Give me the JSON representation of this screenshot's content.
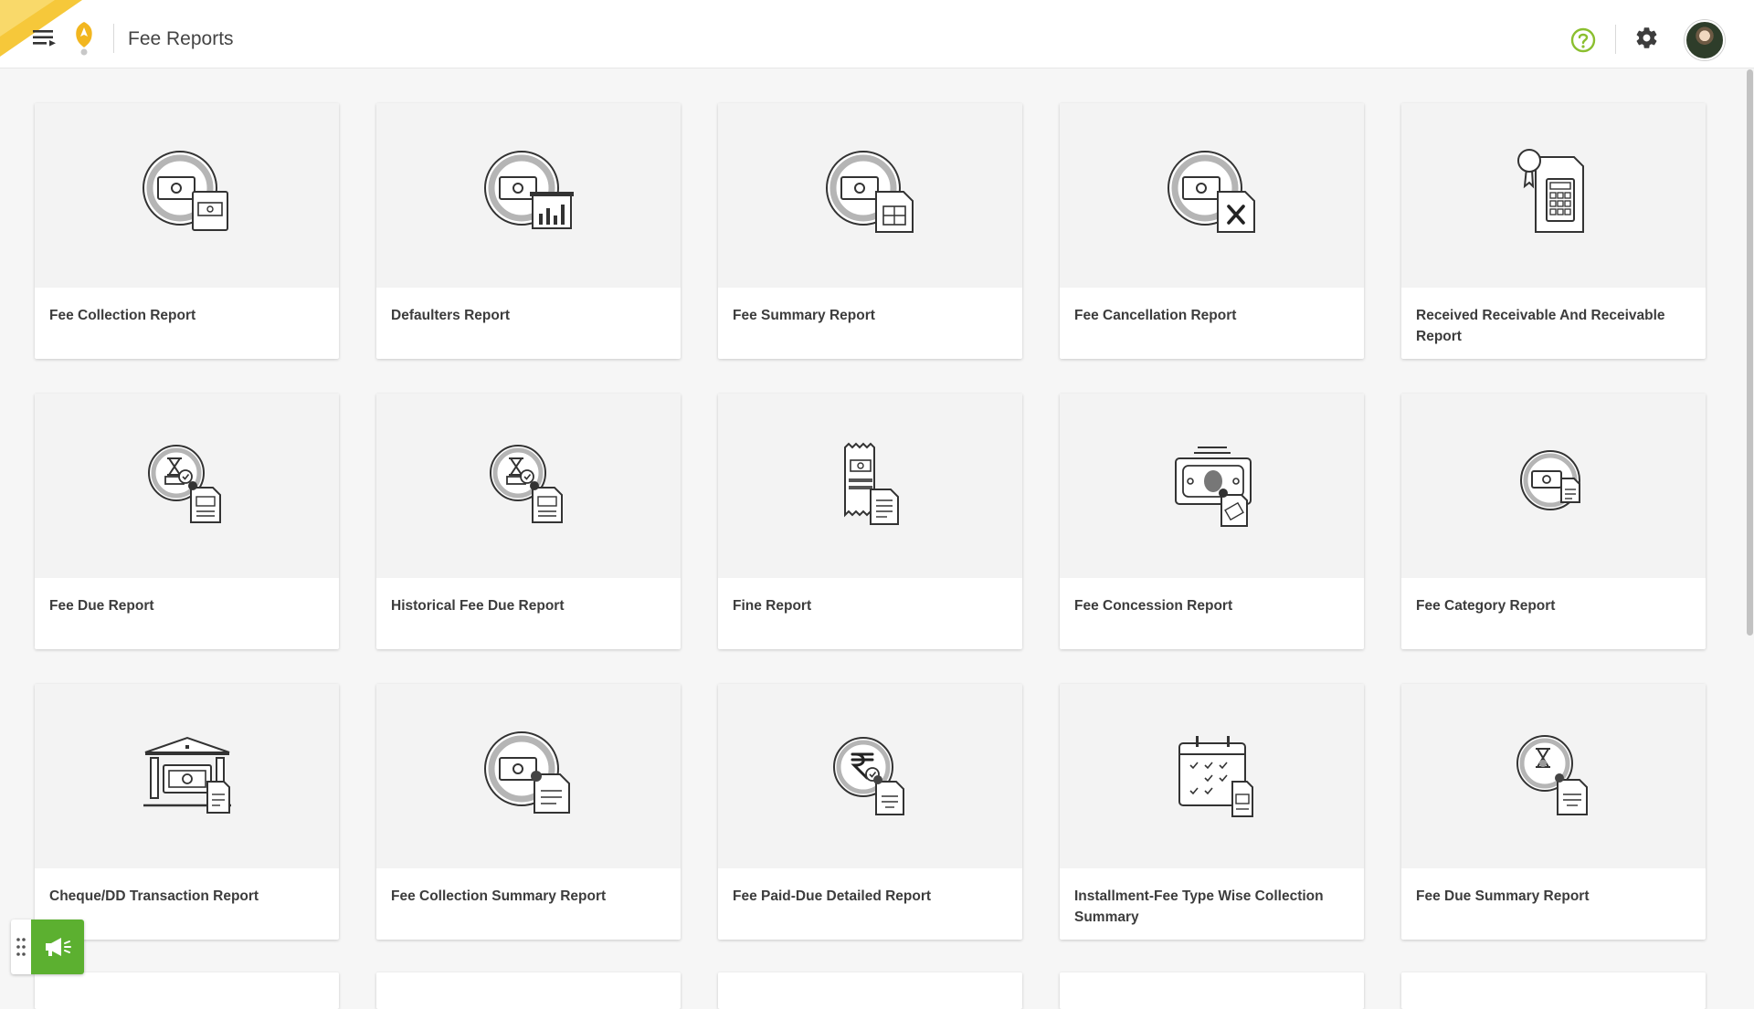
{
  "header": {
    "title": "Fee Reports",
    "menu_icon": "hamburger-menu-icon",
    "logo_icon": "school-logo-icon",
    "help_icon": "help-circle-icon",
    "settings_icon": "gear-icon",
    "avatar": "user-avatar"
  },
  "colors": {
    "accent_green": "#5cb030",
    "help_green": "#8bbf2f",
    "corner_yellow": "#f6c83a"
  },
  "reports": [
    {
      "label": "Fee Collection Report",
      "icon": "money-document-icon"
    },
    {
      "label": "Defaulters Report",
      "icon": "money-bar-chart-icon"
    },
    {
      "label": "Fee Summary Report",
      "icon": "money-table-icon"
    },
    {
      "label": "Fee Cancellation Report",
      "icon": "money-cancel-icon"
    },
    {
      "label": "Received Receivable And Receivable Report",
      "icon": "certificate-calculator-icon"
    },
    {
      "label": "Fee Due Report",
      "icon": "hourglass-money-document-icon"
    },
    {
      "label": "Historical Fee Due Report",
      "icon": "hourglass-history-document-icon"
    },
    {
      "label": "Fine Report",
      "icon": "receipt-document-icon"
    },
    {
      "label": "Fee Concession Report",
      "icon": "banknote-discount-icon"
    },
    {
      "label": "Fee Category Report",
      "icon": "money-stack-icon"
    },
    {
      "label": "Cheque/DD Transaction Report",
      "icon": "bank-money-icon"
    },
    {
      "label": "Fee Collection Summary Report",
      "icon": "money-summary-document-icon"
    },
    {
      "label": "Fee Paid-Due Detailed Report",
      "icon": "rupee-document-icon"
    },
    {
      "label": "Installment-Fee Type Wise Collection Summary",
      "icon": "calendar-checklist-icon"
    },
    {
      "label": "Fee Due Summary Report",
      "icon": "hourglass-summary-document-icon"
    }
  ],
  "widget": {
    "drag_icon": "drag-handle-icon",
    "announce_icon": "megaphone-icon"
  }
}
